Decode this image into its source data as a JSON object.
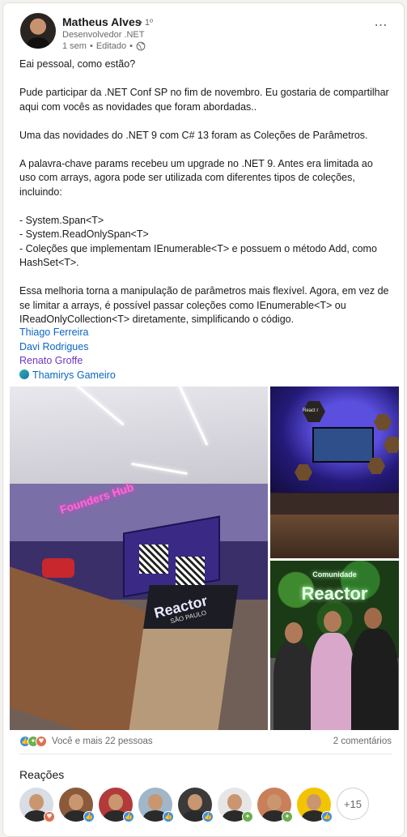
{
  "post": {
    "author": {
      "name": "Matheus Alves",
      "degree": "• 1º",
      "headline": "Desenvolvedor .NET",
      "meta_time": "1 sem",
      "meta_separator": "•",
      "meta_edited": "Editado",
      "meta_separator2": "•",
      "visibility_icon": "globe-icon"
    },
    "more_icon": "…",
    "text": {
      "p1": "Eai pessoal, como estão?",
      "p2": "Pude participar da .NET Conf SP no fim de novembro. Eu gostaria de compartilhar aqui com vocês as novidades que foram abordadas..",
      "p3": "Uma das novidades do .NET 9 com C# 13 foram as Coleções de Parâmetros.",
      "p4": "A palavra-chave params recebeu um upgrade no .NET 9. Antes era limitada ao uso com arrays, agora pode ser utilizada com diferentes tipos de coleções, incluindo:",
      "list1": "- System.Span<T>",
      "list2": "- System.ReadOnlySpan<T>",
      "list3": "- Coleções que implementam IEnumerable<T> e possuem o método Add, como HashSet<T>.",
      "p5": "Essa melhoria torna a manipulação de parâmetros mais flexível. Agora, em vez de se limitar a arrays, é possível passar coleções como IEnumerable<T> ou IReadOnlyCollection<T> diretamente, simplificando o código."
    },
    "mentions": [
      "Thiago Ferreira",
      "Davi Rodrigues",
      "Renato Groffe",
      "Thamirys Gameiro"
    ],
    "photos": {
      "main_neon": "Founders Hub",
      "main_podium": "Reactor",
      "main_podium_sub": "SÃO PAULO",
      "main_screen": "Founders Hub",
      "top_hex_text": "React r",
      "bottom_sign_top": "Comunidade",
      "bottom_sign_main": "Reactor"
    },
    "social": {
      "reactions_text": "Você e mais 22 pessoas",
      "comments_text": "2 comentários",
      "icons": [
        "like-icon",
        "celebrate-icon",
        "love-icon"
      ]
    },
    "reactions_section": {
      "title": "Reações",
      "more_count": "+15"
    }
  },
  "colors": {
    "link": "#0a66c2",
    "visited_link": "#6e36c6",
    "like": "#378fe9",
    "celebrate": "#6dae4f",
    "love": "#df704d"
  }
}
